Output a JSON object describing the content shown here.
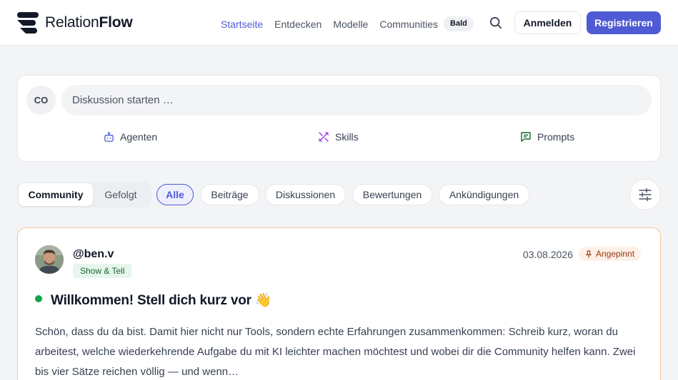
{
  "header": {
    "logo": {
      "prefix": "Relation",
      "strong": "Flow"
    },
    "nav": [
      {
        "label": "Startseite",
        "active": true
      },
      {
        "label": "Entdecken",
        "active": false
      },
      {
        "label": "Modelle",
        "active": false
      },
      {
        "label": "Communities",
        "active": false
      }
    ],
    "soon_badge": "Bald",
    "search_icon": "search-icon",
    "login_label": "Anmelden",
    "register_label": "Registrieren"
  },
  "composer": {
    "avatar_initials": "CO",
    "placeholder": "Diskussion starten …",
    "actions": [
      {
        "label": "Agenten",
        "icon": "robot-icon"
      },
      {
        "label": "Skills",
        "icon": "tools-icon"
      },
      {
        "label": "Prompts",
        "icon": "chat-icon"
      }
    ]
  },
  "feed_tabs": [
    {
      "label": "Community",
      "active": true
    },
    {
      "label": "Gefolgt",
      "active": false
    }
  ],
  "filters": [
    {
      "label": "Alle",
      "active": true
    },
    {
      "label": "Beiträge",
      "active": false
    },
    {
      "label": "Diskussionen",
      "active": false
    },
    {
      "label": "Bewertungen",
      "active": false
    },
    {
      "label": "Ankündigungen",
      "active": false
    }
  ],
  "filter_icon": "sliders-icon",
  "post": {
    "author": "@ben.v",
    "tag": "Show & Tell",
    "date": "03.08.2026",
    "pinned_label": "Angepinnt",
    "title": "Willkommen! Stell dich kurz vor 👋",
    "body": "Schön, dass du da bist. Damit hier nicht nur Tools, sondern echte Erfahrungen zusammenkommen: Schreib kurz, woran du arbeitest, welche wiederkehrende Aufgabe du mit KI leichter machen möchtest und wobei dir die Community helfen kann. Zwei bis vier Sätze reichen völlig — und wenn…"
  },
  "colors": {
    "accent": "#4f5bd5",
    "pinned_border": "#f2c7a0",
    "online_dot": "#16a34a",
    "tag_bg": "#e7f6ec"
  }
}
